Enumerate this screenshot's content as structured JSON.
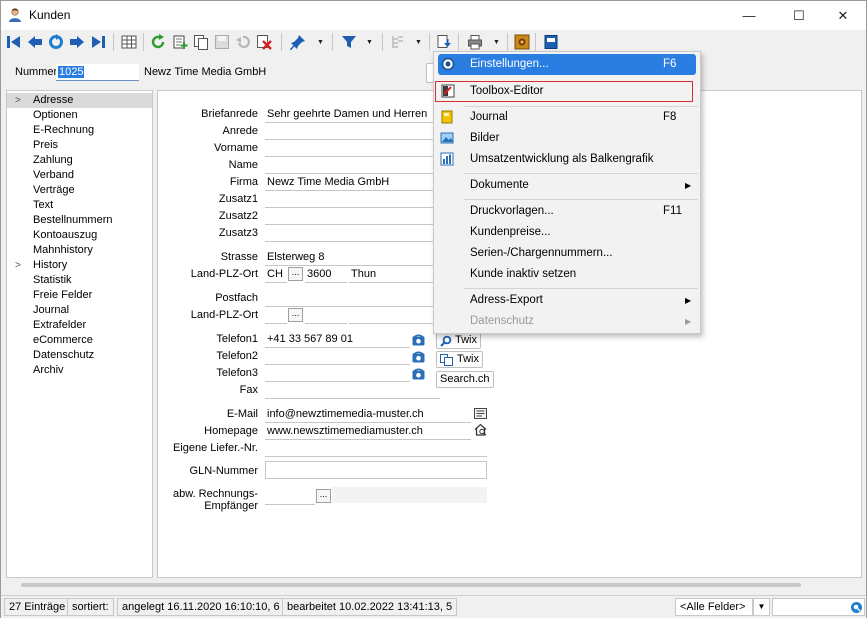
{
  "window": {
    "title": "Kunden",
    "min_glyph": "—",
    "max_glyph": "☐",
    "close_glyph": "✕"
  },
  "header": {
    "number_label": "Nummer",
    "number_value": "1025",
    "company": "Newz Time Media GmbH"
  },
  "nav": {
    "chev": ">",
    "items": [
      {
        "label": "Adresse",
        "selected": true,
        "expand": true
      },
      {
        "label": "Optionen"
      },
      {
        "label": "E-Rechnung"
      },
      {
        "label": "Preis"
      },
      {
        "label": "Zahlung"
      },
      {
        "label": "Verband"
      },
      {
        "label": "Verträge"
      },
      {
        "label": "Text"
      },
      {
        "label": "Bestellnummern"
      },
      {
        "label": "Kontoauszug"
      },
      {
        "label": "Mahnhistory"
      },
      {
        "label": "History",
        "expand": true
      },
      {
        "label": "Statistik"
      },
      {
        "label": "Freie Felder"
      },
      {
        "label": "Journal"
      },
      {
        "label": "Extrafelder"
      },
      {
        "label": "eCommerce"
      },
      {
        "label": "Datenschutz"
      },
      {
        "label": "Archiv"
      }
    ]
  },
  "form": {
    "briefanrede": {
      "label": "Briefanrede",
      "value": "Sehr geehrte Damen und Herren"
    },
    "anrede": {
      "label": "Anrede",
      "value": ""
    },
    "vorname": {
      "label": "Vorname",
      "value": ""
    },
    "name": {
      "label": "Name",
      "value": ""
    },
    "firma": {
      "label": "Firma",
      "value": "Newz Time Media GmbH"
    },
    "zusatz1": {
      "label": "Zusatz1",
      "value": ""
    },
    "zusatz2": {
      "label": "Zusatz2",
      "value": ""
    },
    "zusatz3": {
      "label": "Zusatz3",
      "value": ""
    },
    "strasse": {
      "label": "Strasse",
      "value": "Elsterweg 8"
    },
    "land_plz_ort": {
      "label": "Land-PLZ-Ort",
      "land": "CH",
      "plz": "3600",
      "ort": "Thun"
    },
    "postfach": {
      "label": "Postfach",
      "value": ""
    },
    "land_plz_ort2": {
      "label": "Land-PLZ-Ort",
      "land": "",
      "plz": "",
      "ort": ""
    },
    "ellipsis": "...",
    "telefon1": {
      "label": "Telefon1",
      "value": "+41 33 567 89 01"
    },
    "telefon2": {
      "label": "Telefon2",
      "value": ""
    },
    "telefon3": {
      "label": "Telefon3",
      "value": ""
    },
    "fax": {
      "label": "Fax",
      "value": ""
    },
    "email": {
      "label": "E-Mail",
      "value": "info@newztimemedia-muster.ch"
    },
    "homepage": {
      "label": "Homepage",
      "value": "www.newsztimemediamuster.ch"
    },
    "eigene_liefer_nr": {
      "label": "Eigene Liefer.-Nr.",
      "value": ""
    },
    "gln_nummer": {
      "label": "GLN-Nummer",
      "value": ""
    },
    "abw_rechnungsempfaenger": {
      "label1": "abw. Rechnungs-",
      "label2": "Empfänger",
      "value": ""
    }
  },
  "side_buttons": {
    "twix1": "Twix",
    "twix2": "Twix",
    "search": "Search.ch"
  },
  "context_menu": {
    "items": [
      {
        "label": "Einstellungen...",
        "shortcut": "F6",
        "icon": "settings-icon",
        "highlighted": true
      },
      {
        "label": "Toolbox-Editor",
        "icon": "toolbox-icon",
        "boxed": true
      },
      {
        "label": "Journal",
        "shortcut": "F8",
        "icon": "journal-icon"
      },
      {
        "label": "Bilder",
        "icon": "image-icon"
      },
      {
        "label": "Umsatzentwicklung als Balkengrafik",
        "icon": "bar-chart-icon"
      },
      {
        "label": "Dokumente",
        "submenu": true
      },
      {
        "label": "Druckvorlagen...",
        "shortcut": "F11"
      },
      {
        "label": "Kundenpreise..."
      },
      {
        "label": "Serien-/Chargennummern..."
      },
      {
        "label": "Kunde inaktiv setzen"
      },
      {
        "label": "Adress-Export",
        "submenu": true
      },
      {
        "label": "Datenschutz",
        "submenu": true,
        "disabled": true
      }
    ],
    "arrow_glyph": "▶"
  },
  "status": {
    "entries": "27 Einträge",
    "sorted": "sortiert:",
    "created": "angelegt 16.11.2020 16:10:10,  6",
    "edited": "bearbeitet 10.02.2022 13:41:13,  5",
    "field_select": "<Alle Felder>",
    "dropdown_glyph": "▼"
  },
  "colors": {
    "accent": "#2a7de1",
    "toolbar_blue": "#1e5fb4",
    "highlight_box": "#d32f2f"
  }
}
